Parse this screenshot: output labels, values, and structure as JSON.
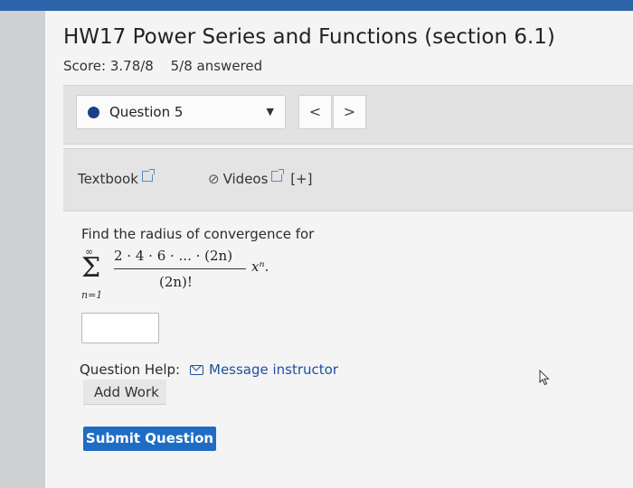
{
  "header": {
    "title": "HW17 Power Series and Functions (section 6.1)",
    "score": "Score: 3.78/8",
    "answered": "5/8 answered"
  },
  "question_nav": {
    "selected": "Question 5",
    "prev_label": "<",
    "next_label": ">"
  },
  "resources": {
    "textbook": "Textbook",
    "videos": "Videos",
    "expand": "[+]"
  },
  "question": {
    "prompt": "Find the radius of convergence for",
    "sum_upper": "∞",
    "sum_lower": "n=1",
    "numerator": "2 · 4 · 6 · ... · (2n)",
    "denominator": "(2n)!",
    "x_term": "xⁿ."
  },
  "answer": {
    "value": ""
  },
  "help": {
    "label": "Question Help:",
    "message": "Message instructor",
    "add_work": "Add Work"
  },
  "submit_label": "Submit Question",
  "colors": {
    "accent": "#1f6cc4",
    "topbar": "#2d63a8",
    "link": "#1f4f9c"
  }
}
